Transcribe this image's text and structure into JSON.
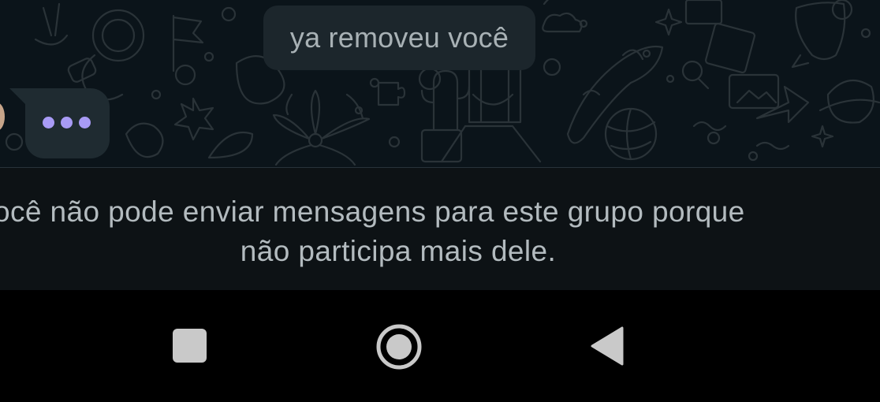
{
  "chat": {
    "system_message": "ya removeu você",
    "typing_indicator": {
      "dots": 3,
      "dot_color": "#a89bf5"
    }
  },
  "notice": {
    "line1": "ocê não pode enviar mensagens para este grupo porque",
    "line2": "não participa mais dele."
  },
  "navigation": {
    "buttons": [
      "recents-button",
      "home-button",
      "back-button"
    ]
  },
  "colors": {
    "chat_background": "#0b141a",
    "pill_background": "#1c262c",
    "notice_background": "#0d1215",
    "notice_text": "#b3bbbf",
    "nav_background": "#000000",
    "nav_icon": "#c9c9c9"
  }
}
